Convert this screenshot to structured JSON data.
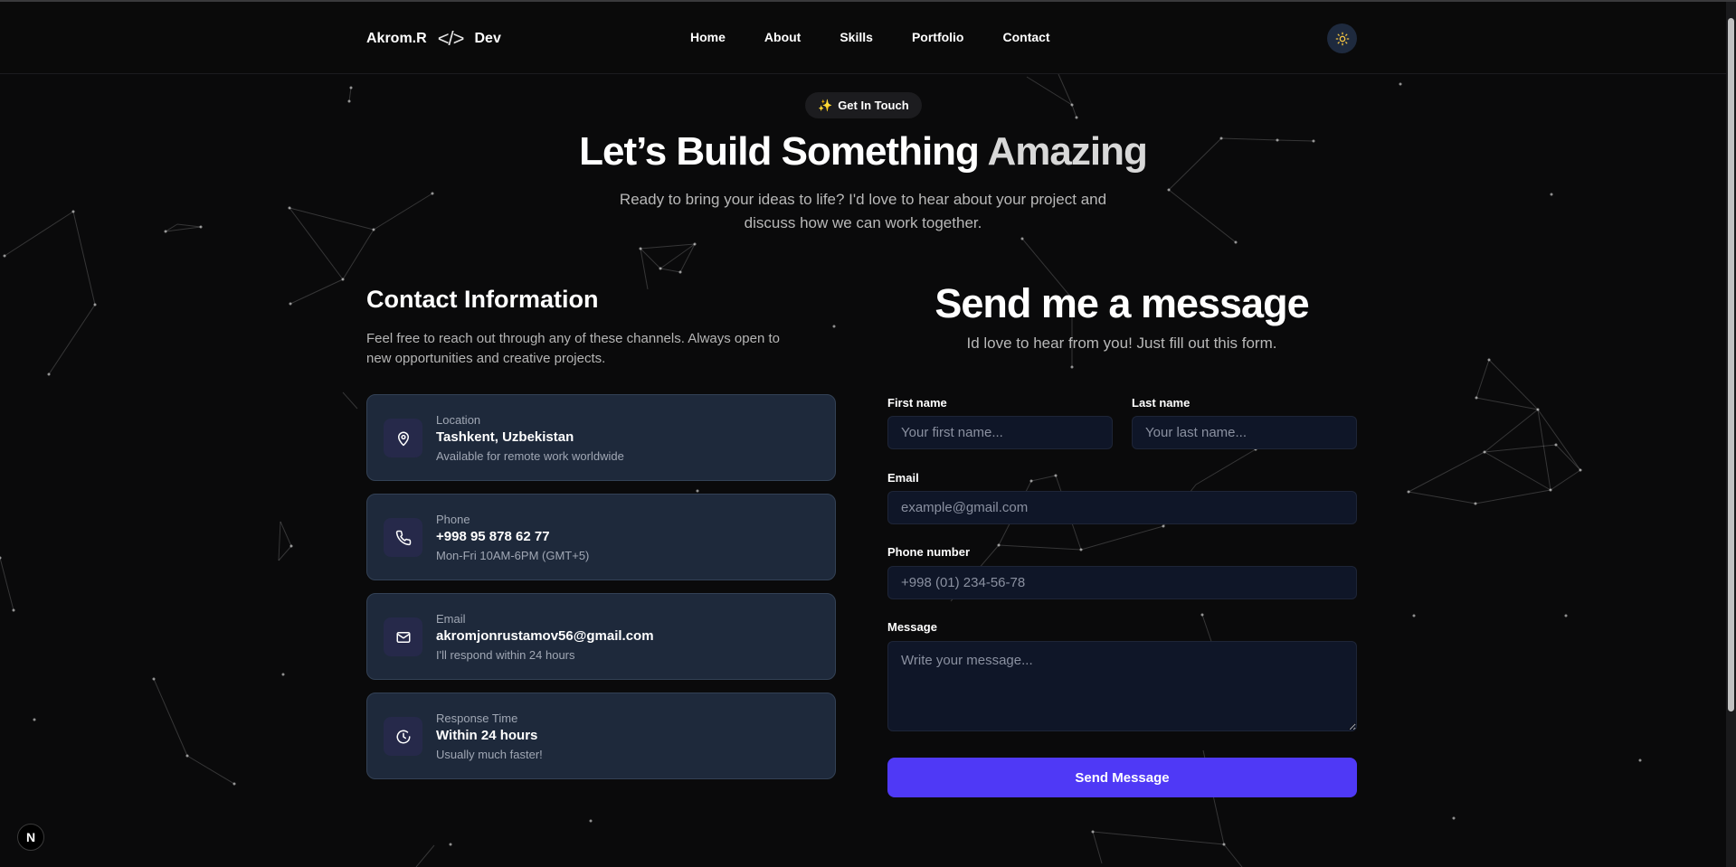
{
  "header": {
    "logo_left": "Akrom.R",
    "logo_code": "</>",
    "logo_right": "Dev",
    "nav": [
      "Home",
      "About",
      "Skills",
      "Portfolio",
      "Contact"
    ],
    "theme_icon": "sun-icon"
  },
  "hero": {
    "badge_icon": "✨",
    "badge_label": "Get In Touch",
    "title_main": "Let’s Build Something",
    "title_accent": "Amazing",
    "subtitle": "Ready to bring your ideas to life? I'd love to hear about your project and discuss how we can work together."
  },
  "contact_info": {
    "title": "Contact Information",
    "description": "Feel free to reach out through any of these channels. Always open to new opportunities and creative projects.",
    "cards": [
      {
        "icon": "map-pin-icon",
        "label": "Location",
        "value": "Tashkent, Uzbekistan",
        "note": "Available for remote work worldwide"
      },
      {
        "icon": "phone-icon",
        "label": "Phone",
        "value": "+998 95 878 62 77",
        "note": "Mon-Fri 10AM-6PM (GMT+5)"
      },
      {
        "icon": "mail-icon",
        "label": "Email",
        "value": "akromjonrustamov56@gmail.com",
        "note": "I'll respond within 24 hours"
      },
      {
        "icon": "clock-icon",
        "label": "Response Time",
        "value": "Within 24 hours",
        "note": "Usually much faster!"
      }
    ]
  },
  "form": {
    "title": "Send me a message",
    "subtitle": "Id love to hear from you! Just fill out this form.",
    "first_name_label": "First name",
    "first_name_placeholder": "Your first name...",
    "last_name_label": "Last name",
    "last_name_placeholder": "Your last name...",
    "email_label": "Email",
    "email_placeholder": "example@gmail.com",
    "phone_label": "Phone number",
    "phone_placeholder": "+998 (01) 234-56-78",
    "message_label": "Message",
    "message_placeholder": "Write your message...",
    "submit_label": "Send Message"
  },
  "dev_badge": "N",
  "colors": {
    "background": "#0a0a0b",
    "card": "#1e293b",
    "input": "#0f1628",
    "accent": "#4f39f6",
    "sun": "#f5c542"
  }
}
